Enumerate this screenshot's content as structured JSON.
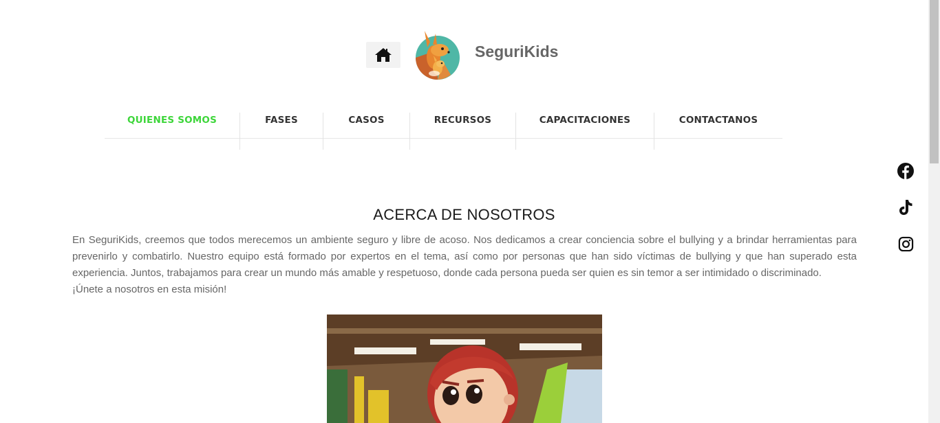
{
  "header": {
    "brand": "SeguriKids",
    "home_icon": "home-icon",
    "logo": "kangaroo-logo"
  },
  "nav": {
    "items": [
      {
        "label": "QUIENES SOMOS",
        "active": true
      },
      {
        "label": "FASES",
        "active": false
      },
      {
        "label": "CASOS",
        "active": false
      },
      {
        "label": "RECURSOS",
        "active": false
      },
      {
        "label": "CAPACITACIONES",
        "active": false
      },
      {
        "label": "CONTACTANOS",
        "active": false
      }
    ],
    "active_color": "#3dd63a"
  },
  "social": {
    "icons": [
      "facebook-icon",
      "tiktok-icon",
      "instagram-icon"
    ]
  },
  "about": {
    "title": "ACERCA DE NOSOTROS",
    "paragraph": "En SeguriKids, creemos que todos merecemos un ambiente seguro y libre de acoso. Nos dedicamos a crear conciencia sobre el bullying y a brindar herramientas para prevenirlo y combatirlo. Nuestro equipo está formado por expertos en el tema, así como por personas que han sido víctimas de bullying y que han superado esta experiencia. Juntos, trabajamos para crear un mundo más amable y respetuoso, donde cada persona pueda ser quien es sin temor a ser intimidado o discriminado.",
    "closing": "¡Únete a nosotros en esta misión!"
  }
}
